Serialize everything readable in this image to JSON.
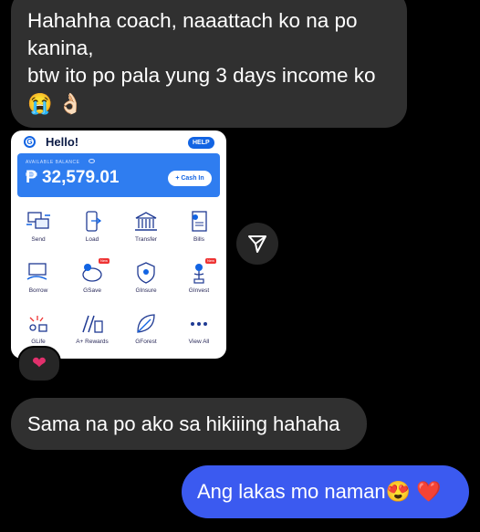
{
  "messages": {
    "incoming_1": {
      "line1": "Hahahha coach, naaattach ko na po",
      "line2": "kanina,",
      "line3": "btw ito po pala yung 3 days income ko",
      "emojis": "😭 👌🏻"
    },
    "incoming_2": {
      "text": "Sama na po ako sa hikiiing hahaha"
    },
    "outgoing_1": {
      "text": "Ang lakas mo naman",
      "emojis": "😍 ❤️"
    }
  },
  "reaction": {
    "emoji": "❤"
  },
  "gcash": {
    "greeting": "Hello!",
    "help_label": "HELP",
    "available_balance_label": "AVAILABLE BALANCE",
    "balance": "₱ 32,579.01",
    "cash_in_label": "+ Cash In",
    "new_badge": "New",
    "services": [
      {
        "label": "Send",
        "icon": "send-icon"
      },
      {
        "label": "Load",
        "icon": "load-icon"
      },
      {
        "label": "Transfer",
        "icon": "bank-icon"
      },
      {
        "label": "Bills",
        "icon": "bills-icon"
      },
      {
        "label": "Borrow",
        "icon": "borrow-icon"
      },
      {
        "label": "GSave",
        "icon": "piggy-bank-icon"
      },
      {
        "label": "GInsure",
        "icon": "insurance-icon"
      },
      {
        "label": "GInvest",
        "icon": "invest-plant-icon"
      },
      {
        "label": "GLife",
        "icon": "shopping-icon"
      },
      {
        "label": "A+ Rewards",
        "icon": "rewards-icon"
      },
      {
        "label": "GForest",
        "icon": "leaf-icon"
      },
      {
        "label": "View All",
        "icon": "more-dots-icon"
      }
    ]
  },
  "colors": {
    "background": "#000000",
    "incoming_bubble": "#303030",
    "outgoing_bubble": "#3b5af0",
    "gcash_blue": "#1264e3"
  }
}
